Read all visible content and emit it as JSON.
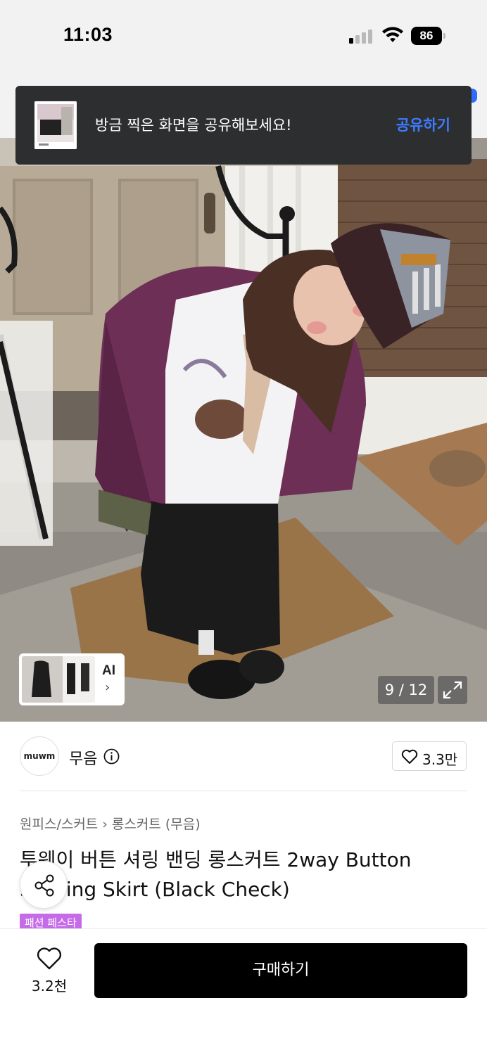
{
  "status_bar": {
    "time": "11:03",
    "battery": "86"
  },
  "toast": {
    "message": "방금 찍은 화면을 공유해보세요!",
    "action": "공유하기"
  },
  "gallery": {
    "counter": "9 / 12",
    "ai_label": "AI",
    "ai_chevron": "›"
  },
  "brand": {
    "logo_text": "muwm",
    "name": "무음",
    "like_count": "3.3만"
  },
  "breadcrumb": {
    "category": "원피스/스커트",
    "separator": "›",
    "subcategory": "롱스커트 (무음)"
  },
  "product": {
    "title": "투웨이 버튼 셔링 밴딩 롱스커트 2way Button Shirring Skirt (Black Check)",
    "tag": "패션 페스타"
  },
  "bottom_bar": {
    "favorite_count": "3.2천",
    "buy_label": "구매하기"
  },
  "icons": {
    "share": "share-icon",
    "heart": "heart-icon",
    "info": "info-icon",
    "expand": "expand-icon",
    "wifi": "wifi-icon",
    "signal": "signal-icon",
    "battery": "battery-icon"
  },
  "colors": {
    "toast_bg": "#2d2e30",
    "toast_action": "#3d7bff",
    "tag_bg": "#c56be8",
    "buy_button": "#000000"
  }
}
